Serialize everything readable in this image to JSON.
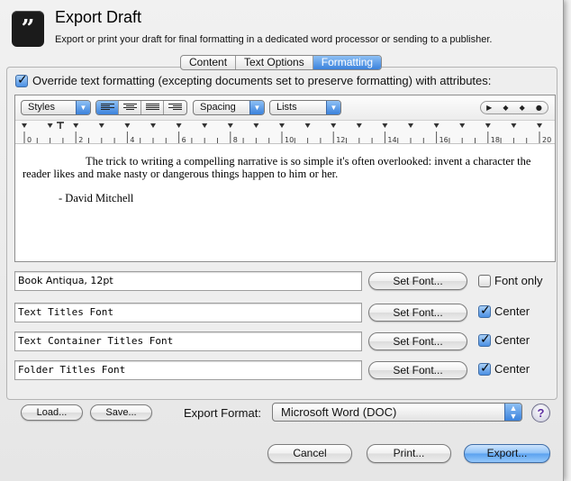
{
  "dialog": {
    "title": "Export Draft",
    "subtitle": "Export or print your draft for final formatting in a dedicated word processor or sending to a publisher.",
    "app_icon_glyph": "”"
  },
  "tabs": [
    {
      "label": "Content",
      "selected": false
    },
    {
      "label": "Text Options",
      "selected": false
    },
    {
      "label": "Formatting",
      "selected": true
    }
  ],
  "override": {
    "checked": true,
    "label": "Override text formatting (excepting documents set to preserve formatting) with attributes:"
  },
  "format_bar": {
    "styles_label": "Styles",
    "spacing_label": "Spacing",
    "lists_label": "Lists",
    "alignment_selected": "left",
    "ruler_controls": [
      "▶",
      "◆",
      "◆",
      "●"
    ]
  },
  "ruler": {
    "labels": [
      "0",
      "2",
      "4",
      "6",
      "8",
      "10",
      "12",
      "14",
      "16",
      "18",
      "20"
    ]
  },
  "preview": {
    "paragraph": "The trick to writing a compelling narrative is so simple it's often overlooked: invent a character the reader likes and make nasty or dangerous things happen to him or her.",
    "attribution": "- David Mitchell"
  },
  "font_rows": [
    {
      "font": "Book Antiqua, 12pt",
      "button": "Set Font...",
      "option_label": "Font only",
      "option_checked": false
    },
    {
      "font": "Text Titles Font",
      "button": "Set Font...",
      "option_label": "Center",
      "option_checked": true
    },
    {
      "font": "Text Container Titles Font",
      "button": "Set Font...",
      "option_label": "Center",
      "option_checked": true
    },
    {
      "font": "Folder Titles Font",
      "button": "Set Font...",
      "option_label": "Center",
      "option_checked": true
    }
  ],
  "bottom": {
    "load_label": "Load...",
    "save_label": "Save...",
    "export_format_label": "Export Format:",
    "export_format_value": "Microsoft Word (DOC)",
    "help_label": "?",
    "cancel_label": "Cancel",
    "print_label": "Print...",
    "export_label": "Export..."
  },
  "colors": {
    "accent": "#3b82dc",
    "help_glyph": "#5b2ca0"
  }
}
